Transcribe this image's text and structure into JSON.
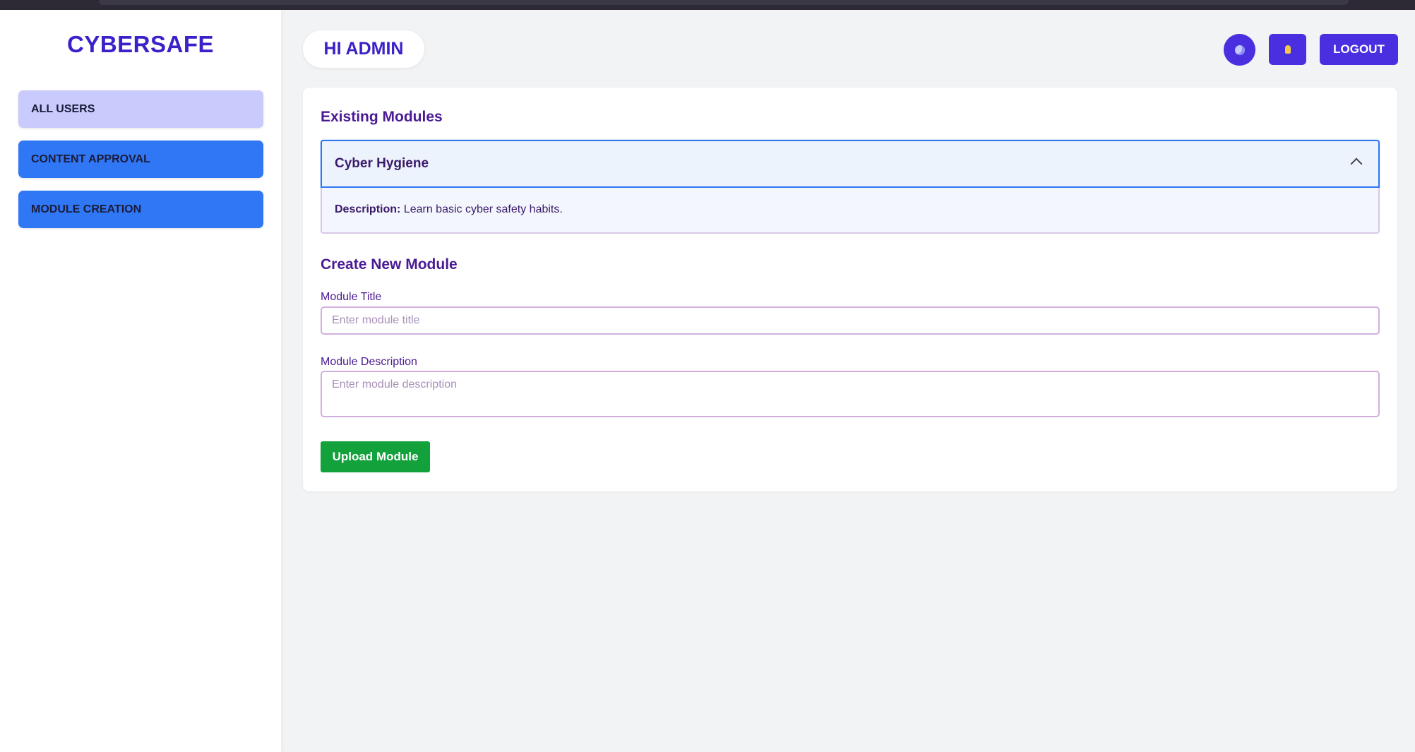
{
  "sidebar": {
    "brand": "CYBERSAFE",
    "items": [
      {
        "label": "ALL USERS"
      },
      {
        "label": "CONTENT APPROVAL"
      },
      {
        "label": "MODULE CREATION"
      }
    ]
  },
  "header": {
    "greeting": "HI ADMIN",
    "theme_icon": "moon-icon",
    "bulb_icon": "bulb-icon",
    "logout_label": "LOGOUT"
  },
  "existing_modules": {
    "title": "Existing Modules",
    "items": [
      {
        "name": "Cyber Hygiene",
        "description_label": "Description:",
        "description": "Learn basic cyber safety habits.",
        "expanded": true
      }
    ]
  },
  "create_module": {
    "title": "Create New Module",
    "title_label": "Module Title",
    "title_placeholder": "Enter module title",
    "description_label": "Module Description",
    "description_placeholder": "Enter module description",
    "upload_label": "Upload Module"
  },
  "colors": {
    "accent": "#4a2fe0",
    "nav_active": "#c8cbfc",
    "nav_button": "#2f77f5",
    "upload_green": "#13a13c",
    "heading_purple": "#4a1a94"
  }
}
